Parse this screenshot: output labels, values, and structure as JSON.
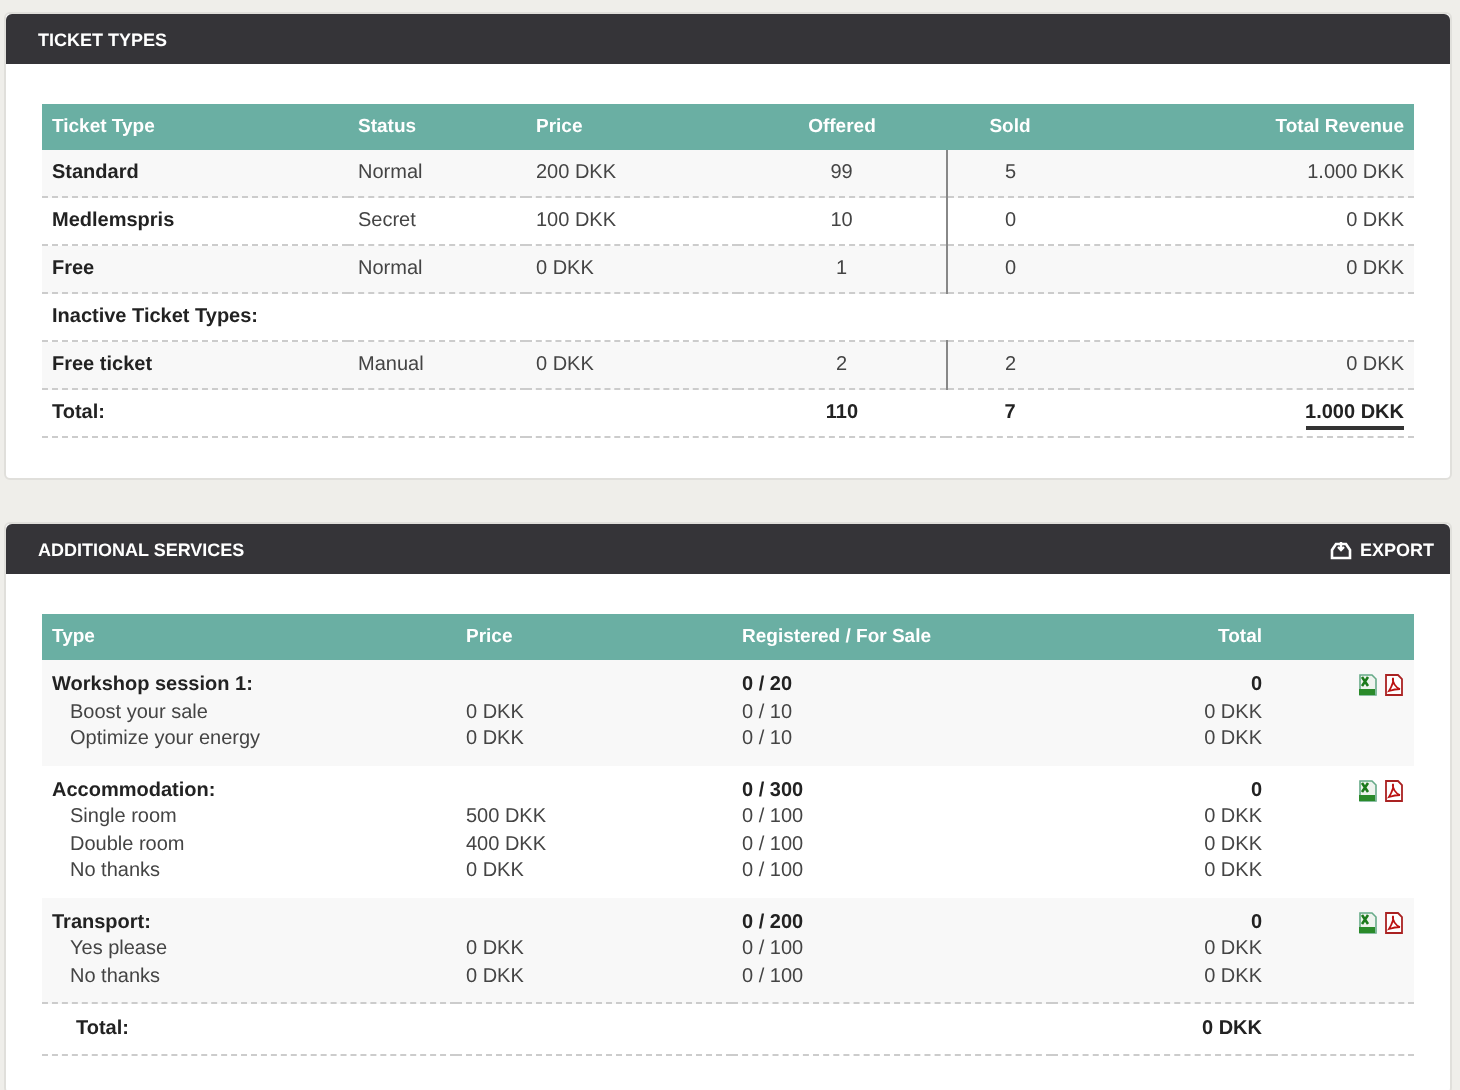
{
  "ticket_types": {
    "title": "TICKET TYPES",
    "columns": [
      "Ticket Type",
      "Status",
      "Price",
      "Offered",
      "Sold",
      "Total Revenue"
    ],
    "rows": [
      {
        "kind": "ticket",
        "name": "Standard",
        "status": "Normal",
        "price": "200 DKK",
        "offered": "99",
        "sold": "5",
        "revenue": "1.000 DKK"
      },
      {
        "kind": "ticket",
        "name": "Medlemspris",
        "status": "Secret",
        "price": "100 DKK",
        "offered": "10",
        "sold": "0",
        "revenue": "0 DKK"
      },
      {
        "kind": "ticket",
        "name": "Free",
        "status": "Normal",
        "price": "0 DKK",
        "offered": "1",
        "sold": "0",
        "revenue": "0 DKK"
      },
      {
        "kind": "section",
        "name": "Inactive Ticket Types:"
      },
      {
        "kind": "ticket",
        "name": "Free ticket",
        "status": "Manual",
        "price": "0 DKK",
        "offered": "2",
        "sold": "2",
        "revenue": "0 DKK"
      },
      {
        "kind": "total",
        "name": "Total:",
        "offered": "110",
        "sold": "7",
        "revenue": "1.000 DKK"
      }
    ]
  },
  "additional_services": {
    "title": "ADDITIONAL SERVICES",
    "export": "EXPORT",
    "columns": [
      "Type",
      "Price",
      "Registered / For Sale",
      "Total"
    ],
    "groups": [
      {
        "name": "Workshop session 1:",
        "registered": "0 / 20",
        "total": "0",
        "items": [
          {
            "name": "Boost your sale",
            "price": "0 DKK",
            "registered": "0 / 10",
            "total": "0 DKK"
          },
          {
            "name": "Optimize your energy",
            "price": "0 DKK",
            "registered": "0 / 10",
            "total": "0 DKK"
          }
        ]
      },
      {
        "name": "Accommodation:",
        "registered": "0 / 300",
        "total": "0",
        "items": [
          {
            "name": "Single room",
            "price": "500 DKK",
            "registered": "0 / 100",
            "total": "0 DKK"
          },
          {
            "name": "Double room",
            "price": "400 DKK",
            "registered": "0 / 100",
            "total": "0 DKK"
          },
          {
            "name": "No thanks",
            "price": "0 DKK",
            "registered": "0 / 100",
            "total": "0 DKK"
          }
        ]
      },
      {
        "name": "Transport:",
        "registered": "0 / 200",
        "total": "0",
        "items": [
          {
            "name": "Yes please",
            "price": "0 DKK",
            "registered": "0 / 100",
            "total": "0 DKK"
          },
          {
            "name": "No thanks",
            "price": "0 DKK",
            "registered": "0 / 100",
            "total": "0 DKK"
          }
        ]
      }
    ],
    "total": {
      "label": "Total:",
      "value": "0 DKK"
    }
  }
}
